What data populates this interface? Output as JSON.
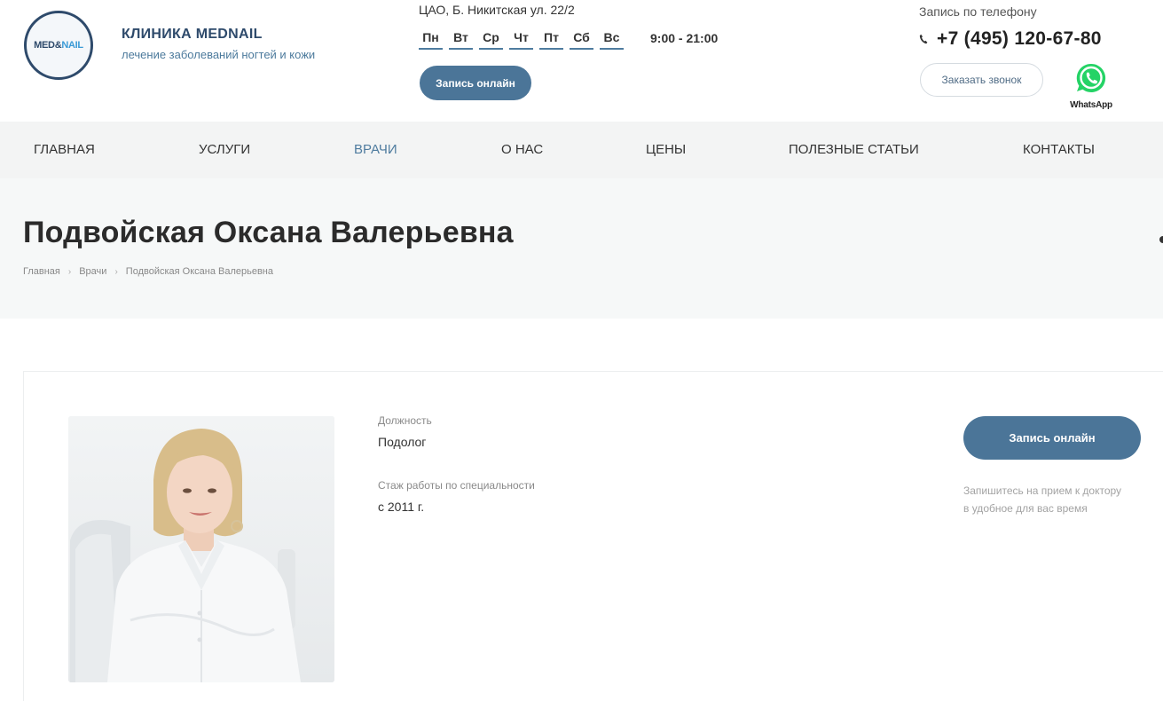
{
  "header": {
    "logo_text_a": "MED&",
    "logo_text_b": "NAIL",
    "brand_title": "КЛИНИКА MEDNAIL",
    "brand_subtitle": "лечение заболеваний ногтей и кожи",
    "address": "ЦАО, Б. Никитская ул. 22/2",
    "days": [
      "Пн",
      "Вт",
      "Ср",
      "Чт",
      "Пт",
      "Сб",
      "Вс"
    ],
    "hours": "9:00 - 21:00",
    "book_online_label": "Запись онлайн",
    "phone_label": "Запись по телефону",
    "phone_number": "+7 (495) 120-67-80",
    "callback_label": "Заказать звонок",
    "whatsapp_label": "WhatsApp"
  },
  "nav": {
    "items": [
      {
        "label": "ГЛАВНАЯ",
        "active": false
      },
      {
        "label": "УСЛУГИ",
        "active": false
      },
      {
        "label": "ВРАЧИ",
        "active": true
      },
      {
        "label": "О НАС",
        "active": false
      },
      {
        "label": "ЦЕНЫ",
        "active": false
      },
      {
        "label": "ПОЛЕЗНЫЕ СТАТЬИ",
        "active": false
      },
      {
        "label": "КОНТАКТЫ",
        "active": false
      }
    ]
  },
  "page": {
    "title": "Подвойская Оксана Валерьевна",
    "breadcrumb": [
      "Главная",
      "Врачи",
      "Подвойская Оксана Валерьевна"
    ]
  },
  "doctor": {
    "position_label": "Должность",
    "position_value": "Подолог",
    "experience_label": "Стаж работы по специальности",
    "experience_value": "с 2011 г.",
    "book_online_label": "Запись онлайн",
    "note_line1": "Запишитесь на прием к доктору",
    "note_line2": "в удобное для вас время"
  },
  "colors": {
    "accent": "#4b7598",
    "brand": "#2e4a6b",
    "nav_bg": "#f3f4f4",
    "whatsapp": "#25d366"
  }
}
